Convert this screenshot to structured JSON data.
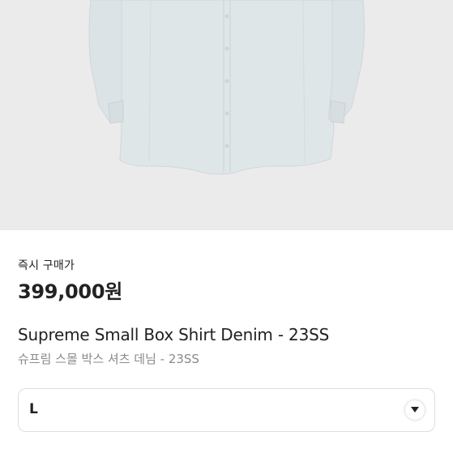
{
  "product": {
    "image_icon": "denim-shirt-image",
    "purchase_label": "즉시 구매가",
    "price": "399,000원",
    "title_en": "Supreme Small Box Shirt Denim - 23SS",
    "title_ko": "슈프림 스몰 박스 셔츠 데님 - 23SS"
  },
  "size_selector": {
    "selected": "L",
    "icon": "chevron-down-icon"
  },
  "colors": {
    "image_background": "#ebebeb",
    "shirt": "#dfe6e8",
    "text_primary": "#222222",
    "text_secondary": "#8a8a8a",
    "border": "#dedede"
  }
}
